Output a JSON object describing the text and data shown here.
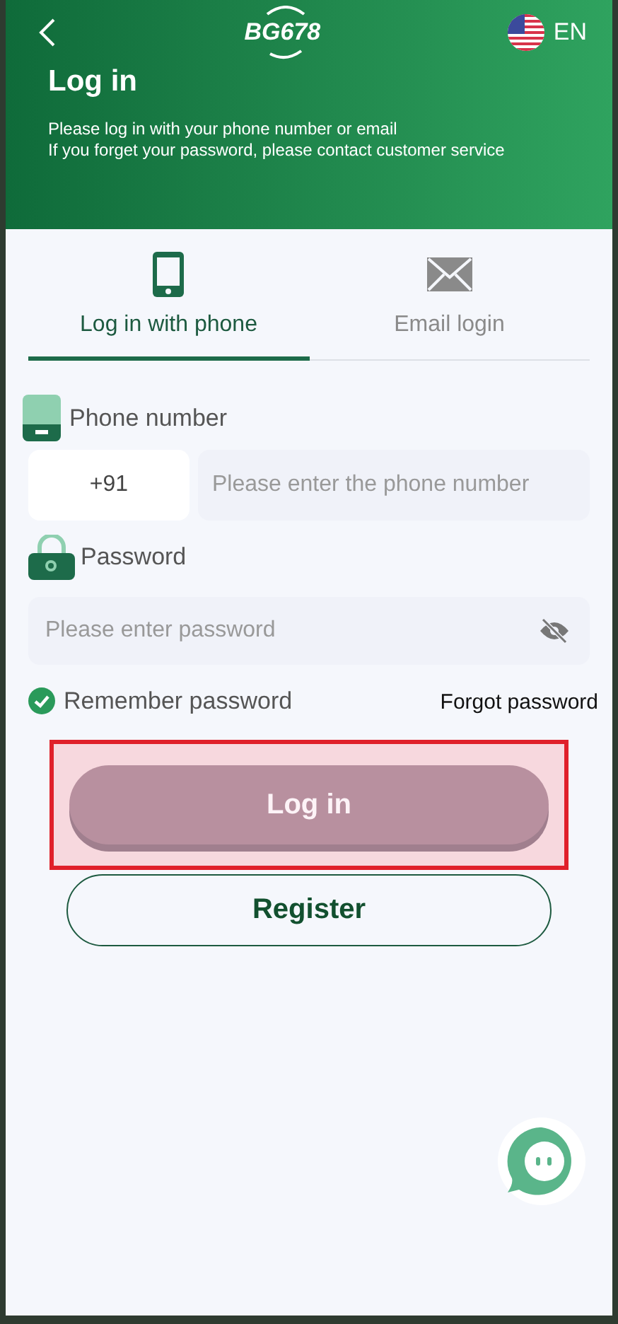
{
  "header": {
    "logo": "BG678",
    "language": "EN",
    "title": "Log in",
    "subtitle_lines": [
      "Please log in with your phone number or email",
      "If you forget your password, please contact customer service"
    ]
  },
  "tabs": [
    {
      "label": "Log in with phone",
      "kind": "phone",
      "selected": true
    },
    {
      "label": "Email login",
      "kind": "email",
      "selected": false
    }
  ],
  "phone": {
    "label": "Phone number",
    "country_code": "+91",
    "placeholder": "Please enter the phone number"
  },
  "password": {
    "label": "Password",
    "placeholder": "Please enter password"
  },
  "remember": {
    "label": "Remember password",
    "checked": true
  },
  "forgot_link": "Forgot password",
  "login_button": {
    "label": "Log in",
    "disabled": true,
    "highlighted": true
  },
  "register_button": "Register"
}
